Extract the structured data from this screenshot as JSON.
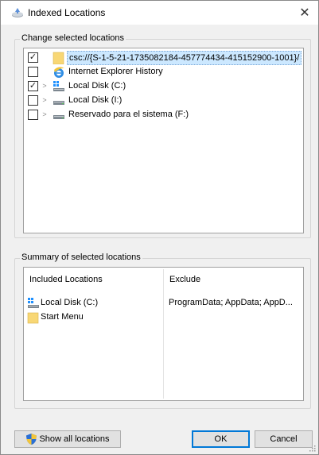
{
  "window": {
    "title": "Indexed Locations",
    "close_symbol": "✕"
  },
  "change_group": {
    "label": "Change selected locations",
    "items": [
      {
        "label": "csc://{S-1-5-21-1735082184-457774434-415152900-1001}/",
        "checked": true,
        "expander": false,
        "icon": "folder-icon",
        "selected": true
      },
      {
        "label": "Internet Explorer History",
        "checked": false,
        "expander": false,
        "icon": "internet-explorer-icon",
        "selected": false
      },
      {
        "label": "Local Disk (C:)",
        "checked": true,
        "expander": true,
        "icon": "windows-drive-icon",
        "selected": false
      },
      {
        "label": "Local Disk (I:)",
        "checked": false,
        "expander": true,
        "icon": "drive-icon",
        "selected": false
      },
      {
        "label": "Reservado para el sistema (F:)",
        "checked": false,
        "expander": true,
        "icon": "drive-icon",
        "selected": false
      }
    ],
    "check_mark": "✓",
    "expander_symbol": ">"
  },
  "summary_group": {
    "label": "Summary of selected locations",
    "included_header": "Included Locations",
    "exclude_header": "Exclude",
    "included": [
      {
        "label": "Local Disk (C:)",
        "icon": "windows-drive-icon"
      },
      {
        "label": "Start Menu",
        "icon": "folder-icon"
      }
    ],
    "excluded": [
      "ProgramData; AppData; AppD..."
    ]
  },
  "buttons": {
    "show_all": "Show all locations",
    "ok": "OK",
    "cancel": "Cancel"
  },
  "colors": {
    "selection": "#cce8ff",
    "default_button_border": "#0078d7",
    "folder_yellow": "#f8d775"
  }
}
